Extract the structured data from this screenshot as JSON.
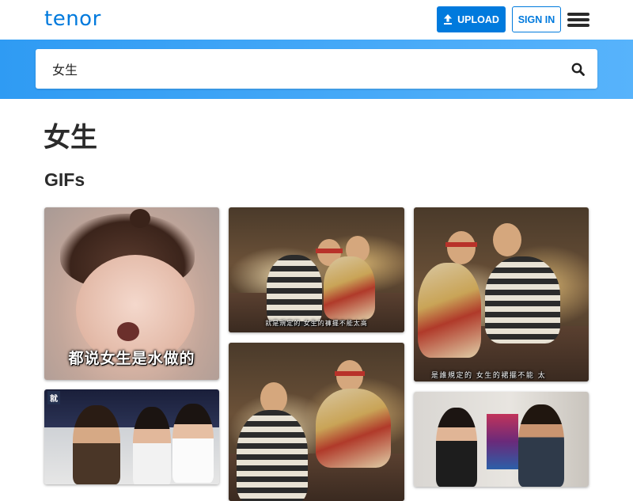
{
  "navbar": {
    "logo": "tenor",
    "upload_label": "UPLOAD",
    "signin_label": "SIGN IN",
    "upload_icon": "upload-arrow-icon",
    "menu_icon": "hamburger-menu-icon"
  },
  "search": {
    "value": "女生",
    "icon": "search-icon"
  },
  "page": {
    "title": "女生",
    "section": "GIFs"
  },
  "gifs": [
    {
      "caption": "都说女生是水做的"
    },
    {
      "caption": "就是規定的 女生的褲擺不能太高"
    },
    {
      "caption": "是誰規定的 女生的裙擺不能 太"
    },
    {
      "caption": ""
    },
    {
      "caption": "",
      "tag": "就"
    },
    {
      "caption": ""
    }
  ],
  "colors": {
    "brand": "#007add",
    "search_band_start": "#2f9bf3",
    "search_band_end": "#57b3fb",
    "text": "#2b2b2b"
  }
}
